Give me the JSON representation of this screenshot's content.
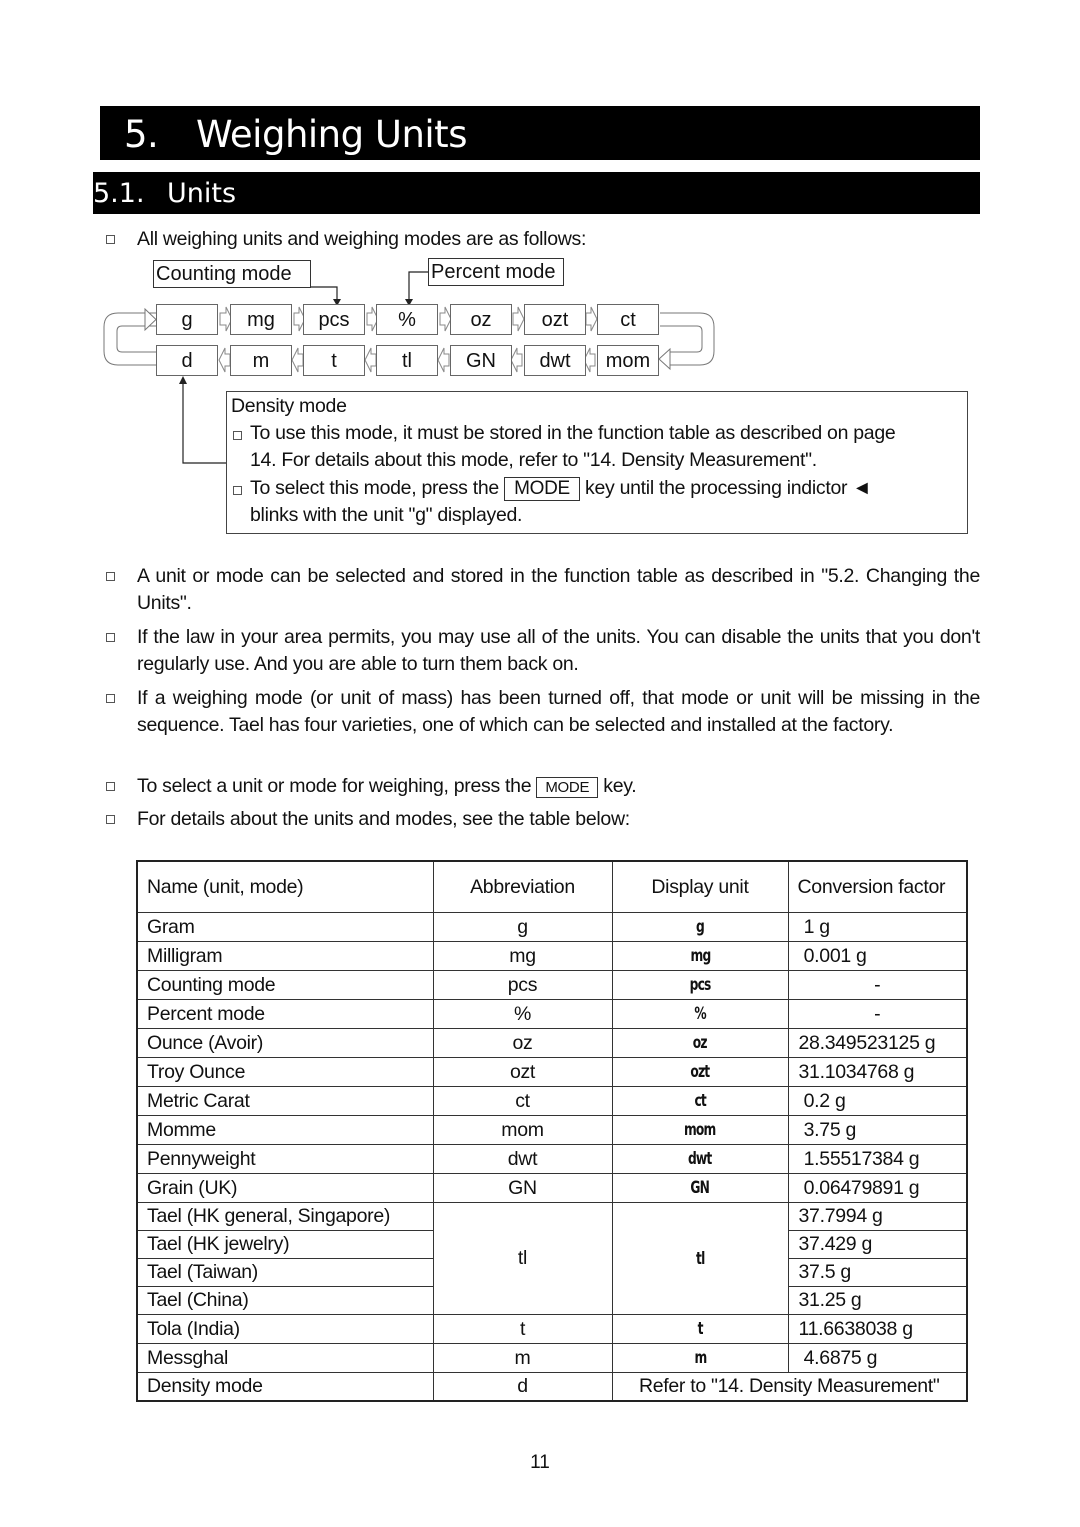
{
  "heading1": {
    "number": "5.",
    "title": "Weighing Units"
  },
  "heading2": {
    "number": "5.1.",
    "title": "Units"
  },
  "intro": "All weighing units and weighing modes are as follows:",
  "diagram": {
    "counting_label": "Counting   mode",
    "percent_label": "Percent mode",
    "top_row": [
      "g",
      "mg",
      "pcs",
      "%",
      "oz",
      "ozt",
      "ct"
    ],
    "bottom_row": [
      "d",
      "m",
      "t",
      "tl",
      "GN",
      "dwt",
      "mom"
    ],
    "density": {
      "title": "Density mode",
      "bullet1_line1": "To use this mode, it must be stored in the function table as described on page",
      "bullet1_line2": "14. For details about this mode, refer to \"14. Density Measurement\".",
      "bullet2_pre": "To select this mode, press the",
      "bullet2_key": "MODE",
      "bullet2_post": "key until the processing indictor ◄",
      "bullet2_line2": "blinks with the unit \"g\" displayed."
    }
  },
  "bullets": [
    {
      "text": "A unit or mode can be selected and stored in the function table as described in \"5.2. Changing the Units\"."
    },
    {
      "text": "If the law in your area permits, you may use all of the units. You can disable the units that you don't regularly use. And you are able to turn them back on."
    },
    {
      "text": "If a weighing mode (or unit of mass) has been turned off, that mode or unit will be missing in the sequence. Tael has four varieties, one of which can be selected and installed at the factory."
    },
    {
      "pre": "To select a unit or mode for weighing, press the",
      "key": "MODE",
      "post": "key."
    },
    {
      "text": "For details about the units and modes, see the table below:"
    }
  ],
  "table": {
    "headers": [
      "Name (unit, mode)",
      "Abbreviation",
      "Display unit",
      "Conversion factor"
    ],
    "rows": [
      {
        "name": "Gram",
        "abbr": "g",
        "display": "g",
        "factor": " 1 g"
      },
      {
        "name": "Milligram",
        "abbr": "mg",
        "display": "mg",
        "factor": " 0.001 g"
      },
      {
        "name": "Counting mode",
        "abbr": "pcs",
        "display": "pcs",
        "factor": "-"
      },
      {
        "name": "Percent mode",
        "abbr": "%",
        "display": "%",
        "factor": "-"
      },
      {
        "name": "Ounce (Avoir)",
        "abbr": "oz",
        "display": "oz",
        "factor": "28.349523125 g"
      },
      {
        "name": "Troy Ounce",
        "abbr": "ozt",
        "display": "ozt",
        "factor": "31.1034768 g"
      },
      {
        "name": "Metric Carat",
        "abbr": "ct",
        "display": "ct",
        "factor": " 0.2 g"
      },
      {
        "name": "Momme",
        "abbr": "mom",
        "display": "mom",
        "factor": " 3.75 g"
      },
      {
        "name": "Pennyweight",
        "abbr": "dwt",
        "display": "dwt",
        "factor": " 1.55517384 g"
      },
      {
        "name": "Grain (UK)",
        "abbr": "GN",
        "display": "GN",
        "factor": " 0.06479891 g"
      },
      {
        "name": "Tael (HK general, Singapore)",
        "factor": "37.7994 g"
      },
      {
        "name": "Tael (HK jewelry)",
        "factor": "37.429 g"
      },
      {
        "name": "Tael (Taiwan)",
        "factor": "37.5 g"
      },
      {
        "name": "Tael (China)",
        "factor": "31.25 g"
      },
      {
        "name": "Tola (India)",
        "abbr": "t",
        "display": "t",
        "factor": "11.6638038 g"
      },
      {
        "name": "Messghal",
        "abbr": "m",
        "display": "m",
        "factor": " 4.6875 g"
      },
      {
        "name": "Density mode",
        "abbr": "d",
        "merged": "Refer to \"14. Density Measurement\""
      }
    ],
    "tael_abbr": "tl",
    "tael_display": "tl"
  },
  "page_number": "11"
}
